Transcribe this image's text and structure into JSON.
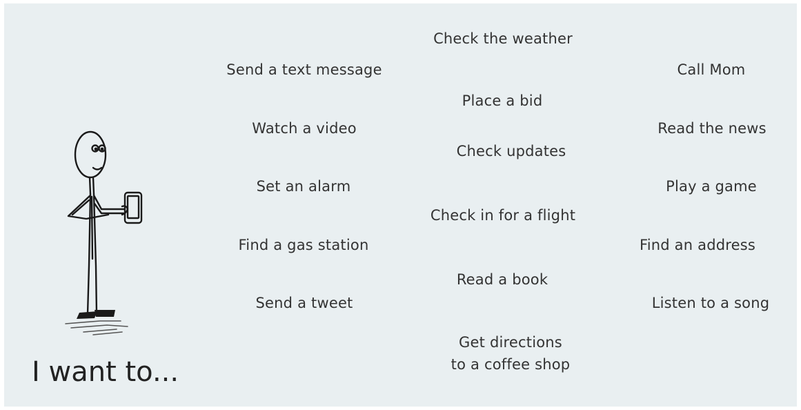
{
  "caption": "I want to...",
  "tasks": {
    "check_weather": "Check the weather",
    "send_text": "Send a text message",
    "call_mom": "Call Mom",
    "place_bid": "Place a bid",
    "watch_video": "Watch a video",
    "read_news": "Read the news",
    "check_updates": "Check updates",
    "set_alarm": "Set an alarm",
    "play_game": "Play a game",
    "check_in_flight": "Check in for a flight",
    "find_gas_station": "Find a gas station",
    "find_address": "Find an address",
    "read_book": "Read a book",
    "send_tweet": "Send a tweet",
    "listen_song": "Listen to a song",
    "get_directions_line1": "Get directions",
    "get_directions_line2": "to a coffee shop"
  },
  "colors": {
    "background": "#e9eff1",
    "text": "#333333",
    "figure_stroke": "#1a1a1a"
  },
  "icons": {
    "figure": "stick-figure-with-phone-icon"
  }
}
